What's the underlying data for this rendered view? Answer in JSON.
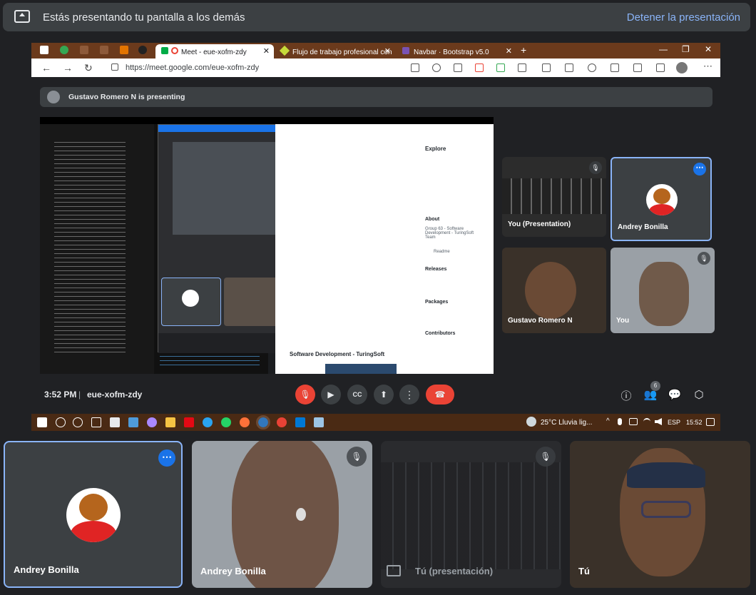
{
  "banner": {
    "message": "Estás presentando tu pantalla a los demás",
    "stop_label": "Detener la presentación"
  },
  "browser": {
    "tabs": [
      {
        "label": "Meet - eue-xofm-zdy",
        "active": true
      },
      {
        "label": "Flujo de trabajo profesional con",
        "active": false
      },
      {
        "label": "Navbar · Bootstrap v5.0",
        "active": false
      }
    ],
    "url": "https://meet.google.com/eue-xofm-zdy"
  },
  "meet": {
    "presenting_banner": "Gustavo Romero N is presenting",
    "side_tiles": [
      {
        "name": "You (Presentation)"
      },
      {
        "name": "Andrey Bonilla"
      },
      {
        "name": "Gustavo Romero N"
      },
      {
        "name": "You"
      }
    ],
    "nested_screen": {
      "github_explore": "Explore",
      "about_heading": "About",
      "about_text": "Group 63 - Software Development - TuringSoft Team",
      "readme": "Readme",
      "releases": "Releases",
      "packages": "Packages",
      "contributors": "Contributors",
      "repo_title": "Software Development - TuringSoft"
    },
    "clock": "3:52 PM",
    "meeting_code": "eue-xofm-zdy",
    "people_count": "6"
  },
  "taskbar": {
    "weather": "25°C  Lluvia lig...",
    "lang": "ESP",
    "time": "15:52"
  },
  "tiles": [
    {
      "name": "Andrey Bonilla"
    },
    {
      "name": "Andrey Bonilla"
    },
    {
      "name": "Tú (presentación)"
    },
    {
      "name": "Tú"
    }
  ],
  "colors": {
    "accent": "#8ab4f8",
    "hangup": "#ea4335",
    "highlight_border": "#8ab4f8",
    "more_button": "#1a73e8"
  }
}
